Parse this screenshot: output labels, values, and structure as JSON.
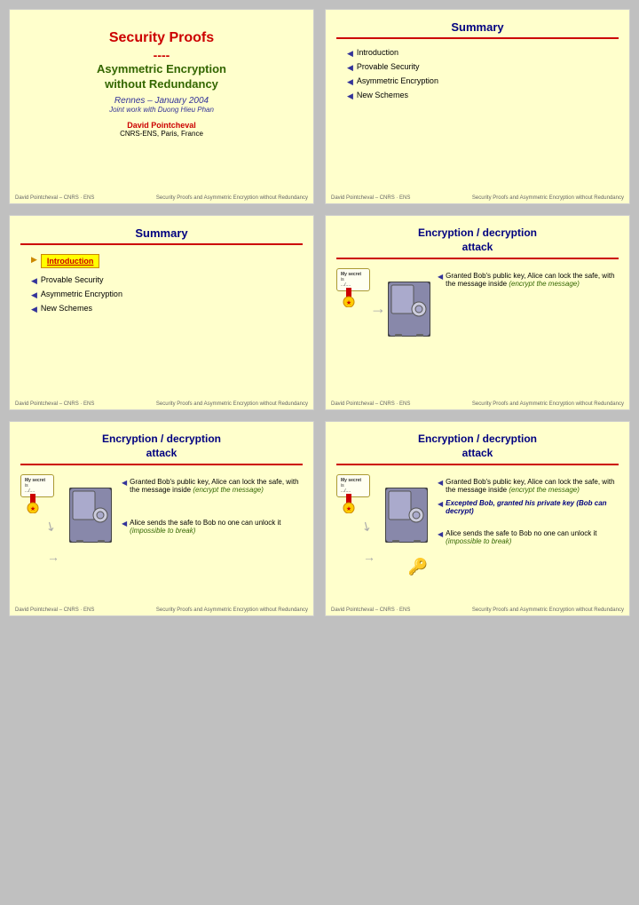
{
  "slides": [
    {
      "id": "slide1",
      "title_line1": "Security Proofs",
      "title_dashes": "----",
      "title_line2": "Asymmetric Encryption",
      "title_line3": "without Redundancy",
      "location": "Rennes – January 2004",
      "joint_work": "Joint work with Duong Hieu Phan",
      "author": "David Pointcheval",
      "institution": "CNRS-ENS, Paris, France",
      "footer_left": "David Pointcheval – CNRS · ENS",
      "footer_right": "Security Proofs and Asymmetric Encryption without Redundancy"
    },
    {
      "id": "slide2",
      "header": "Summary",
      "items": [
        "Introduction",
        "Provable Security",
        "Asymmetric Encryption",
        "New Schemes"
      ],
      "footer_left": "David Pointcheval – CNRS · ENS",
      "footer_right": "Security Proofs and Asymmetric Encryption without Redundancy"
    },
    {
      "id": "slide3",
      "header": "Summary",
      "highlighted_item": "Introduction",
      "items": [
        "Provable Security",
        "Asymmetric Encryption",
        "New Schemes"
      ],
      "footer_left": "David Pointcheval – CNRS · ENS",
      "footer_right": "Security Proofs and Asymmetric Encryption without Redundancy"
    },
    {
      "id": "slide4",
      "header_line1": "Encryption / decryption",
      "header_line2": "attack",
      "scroll_label": "My secret is .../...",
      "bullets": [
        {
          "text": "Granted Bob's public key, Alice can lock the safe, with the message inside",
          "italic": "(encrypt the message)"
        }
      ],
      "footer_left": "David Pointcheval – CNRS · ENS",
      "footer_right": "Security Proofs and Asymmetric Encryption without Redundancy"
    },
    {
      "id": "slide5",
      "header_line1": "Encryption / decryption",
      "header_line2": "attack",
      "scroll_label": "My secret is .../...",
      "bullets_top": [
        {
          "text": "Granted Bob's public key, Alice can lock the safe, with the message inside",
          "italic": "(encrypt the message)"
        }
      ],
      "bullets_bottom": [
        {
          "text": "Alice sends the safe to Bob no one can unlock it",
          "italic": "(impossible to break)"
        }
      ],
      "footer_left": "David Pointcheval – CNRS · ENS",
      "footer_right": "Security Proofs and Asymmetric Encryption without Redundancy"
    },
    {
      "id": "slide6",
      "header_line1": "Encryption / decryption",
      "header_line2": "attack",
      "scroll_label": "My secret is .../...",
      "bullets_top": [
        {
          "text": "Granted Bob's public key, Alice can lock the safe, with the message inside",
          "italic": "(encrypt the message)"
        }
      ],
      "bullets_middle": [
        {
          "text": "Excepted Bob, granted his private key",
          "italic": "(Bob can decrypt)",
          "italic_style": true
        }
      ],
      "bullets_bottom": [
        {
          "text": "Alice sends the safe to Bob no one can unlock it",
          "italic": "(impossible to break)"
        }
      ],
      "footer_left": "David Pointcheval – CNRS · ENS",
      "footer_right": "Security Proofs and Asymmetric Encryption without Redundancy"
    }
  ]
}
